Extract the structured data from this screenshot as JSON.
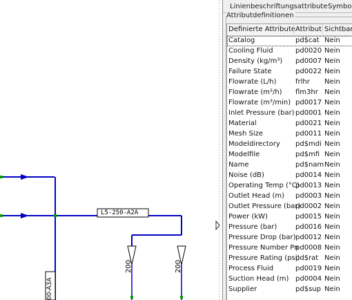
{
  "tabs": [
    "Linienbeschriftungsattribute",
    "Symbol-G"
  ],
  "group_title": "Attributdefinitionen",
  "columns": [
    "Definierte Attribute",
    "Attribut",
    "Sichtbar"
  ],
  "rows": [
    [
      "Catalog",
      "pd$cat",
      "Nein"
    ],
    [
      "Cooling Fluid",
      "pd0020",
      "Nein"
    ],
    [
      "Density (kg/m³)",
      "pd0007",
      "Nein"
    ],
    [
      "Failure State",
      "pd0022",
      "Nein"
    ],
    [
      "Flowrate (L/h)",
      "frlhr",
      "Nein"
    ],
    [
      "Flowrate (m³/h)",
      "flm3hr",
      "Nein"
    ],
    [
      "Flowrate (m³/min)",
      "pd0017",
      "Nein"
    ],
    [
      "Inlet Pressure (bar)",
      "pd0001",
      "Nein"
    ],
    [
      "Material",
      "pd0021",
      "Nein"
    ],
    [
      "Mesh Size",
      "pd0011",
      "Nein"
    ],
    [
      "Modeldirectory",
      "pd$mdi",
      "Nein"
    ],
    [
      "Modelfile",
      "pd$mfi",
      "Nein"
    ],
    [
      "Name",
      "pd$nam",
      "Nein"
    ],
    [
      "Noise (dB)",
      "pd0014",
      "Nein"
    ],
    [
      "Operating Temp (°C)",
      "pd0013",
      "Nein"
    ],
    [
      "Outlet Head (m)",
      "pd0003",
      "Nein"
    ],
    [
      "Outlet Pressure (bar)",
      "pd0002",
      "Nein"
    ],
    [
      "Power (kW)",
      "pd0015",
      "Nein"
    ],
    [
      "Pressure (bar)",
      "pd0016",
      "Nein"
    ],
    [
      "Pressure Drop (bar)",
      "pd0012",
      "Nein"
    ],
    [
      "Pressure Number Pn",
      "pd0008",
      "Nein"
    ],
    [
      "Pressure Rating (psi)",
      "pd$rat",
      "Nein"
    ],
    [
      "Process Fluid",
      "pd0019",
      "Nein"
    ],
    [
      "Suction Head (m)",
      "pd0004",
      "Nein"
    ],
    [
      "Supplier",
      "pd$sup",
      "Nein"
    ]
  ],
  "drawing": {
    "line_tag": "L5-250-A2A",
    "reducer_left_label": "200",
    "reducer_right_label": "200",
    "vertical_tag": "00-A3A",
    "pipe_color": "#0000c8",
    "node_color": "#00a000"
  }
}
